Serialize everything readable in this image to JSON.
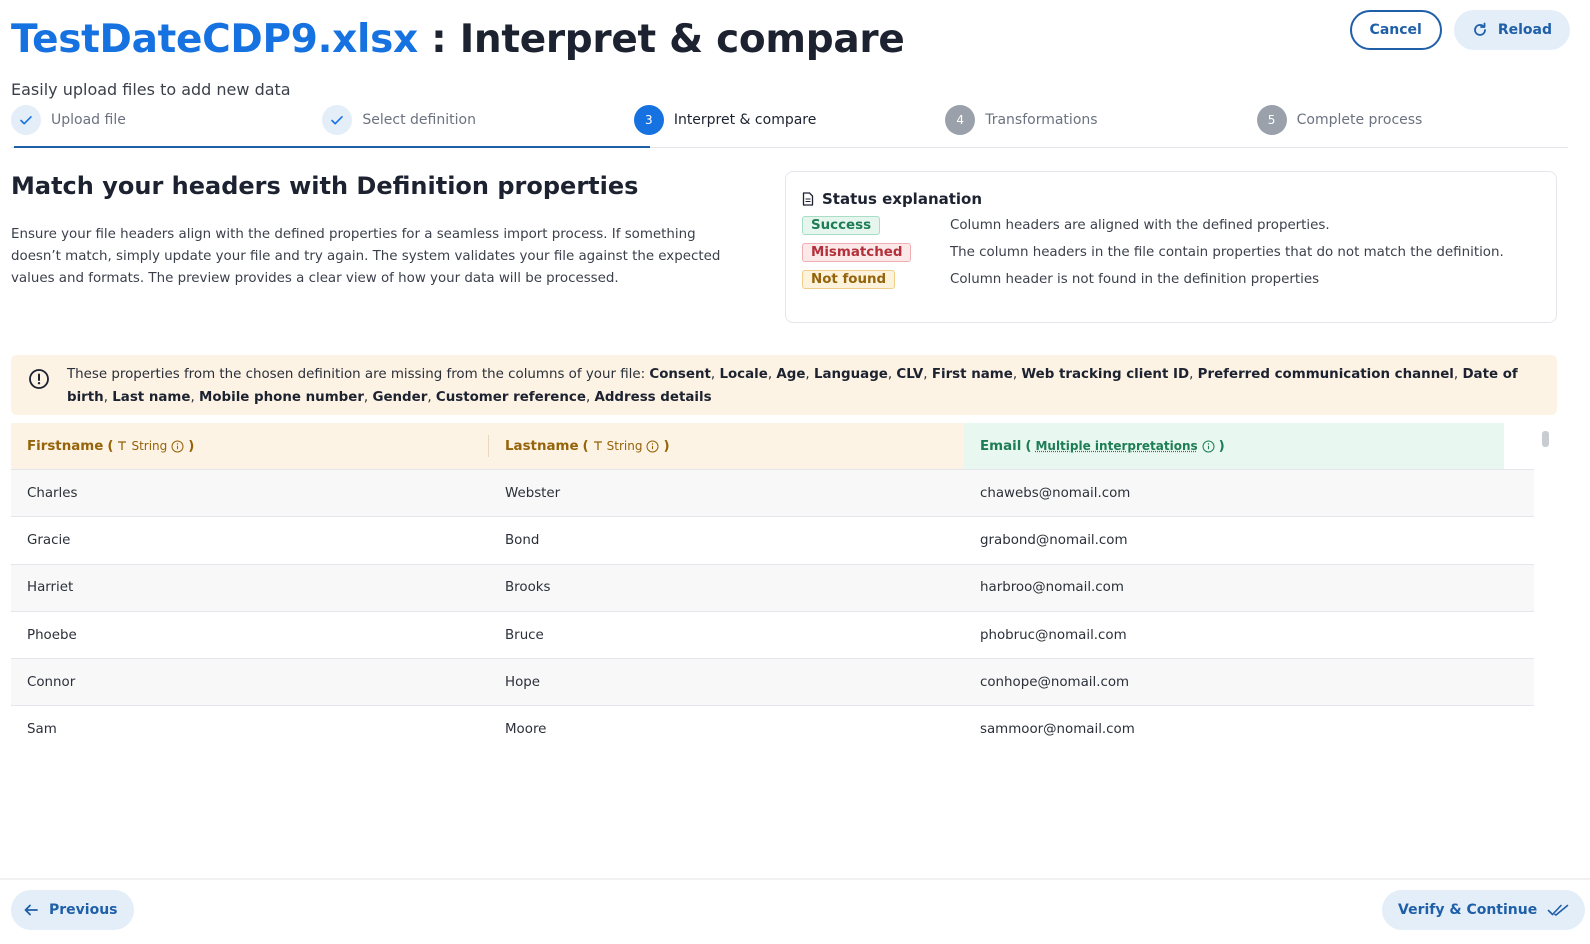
{
  "header": {
    "file_name": "TestDateCDP9.xlsx",
    "title_suffix": " : Interpret & compare",
    "subtitle": "Easily upload files to add new data",
    "cancel_label": "Cancel",
    "reload_label": "Reload"
  },
  "steps": [
    {
      "label": "Upload file",
      "state": "done",
      "number": "1"
    },
    {
      "label": "Select definition",
      "state": "done",
      "number": "2"
    },
    {
      "label": "Interpret & compare",
      "state": "active",
      "number": "3"
    },
    {
      "label": "Transformations",
      "state": "todo",
      "number": "4"
    },
    {
      "label": "Complete process",
      "state": "todo",
      "number": "5"
    }
  ],
  "match": {
    "heading": "Match your headers with Definition properties",
    "description": "Ensure your file headers align with the defined properties for a seamless import process. If something doesn’t match, simply update your file and try again. The system validates your file against the expected values and formats. The preview provides a clear view of how your data will be processed."
  },
  "status": {
    "heading": "Status explanation",
    "rows": [
      {
        "badge": "Success",
        "text": "Column headers are aligned with the defined properties."
      },
      {
        "badge": "Mismatched",
        "text": "The column headers in the file contain properties that do not match the definition."
      },
      {
        "badge": "Not found",
        "text": "Column header is not found in the definition properties"
      }
    ]
  },
  "alert": {
    "intro": "These properties from the chosen definition are missing from the columns of your file:",
    "missing": [
      "Consent",
      "Locale",
      "Age",
      "Language",
      "CLV",
      "First name",
      "Web tracking client ID",
      "Preferred communication channel",
      "Date of birth",
      "Last name",
      "Mobile phone number",
      "Gender",
      "Customer reference",
      "Address details"
    ]
  },
  "table": {
    "columns": [
      {
        "name": "Firstname",
        "type": "String"
      },
      {
        "name": "Lastname",
        "type": "String"
      },
      {
        "name": "Email",
        "type": "Multiple interpretations"
      }
    ],
    "rows": [
      [
        "Charles",
        "Webster",
        "chawebs@nomail.com"
      ],
      [
        "Gracie",
        "Bond",
        "grabond@nomail.com"
      ],
      [
        "Harriet",
        "Brooks",
        "harbroo@nomail.com"
      ],
      [
        "Phoebe",
        "Bruce",
        "phobruc@nomail.com"
      ],
      [
        "Connor",
        "Hope",
        "conhope@nomail.com"
      ],
      [
        "Sam",
        "Moore",
        "sammoor@nomail.com"
      ]
    ]
  },
  "footer": {
    "previous_label": "Previous",
    "next_label": "Verify & Continue"
  },
  "colors": {
    "brand": "#1672e0",
    "button_text": "#1f5fa8",
    "warning_bg": "#fdf3e4",
    "success_bg": "#e8f7ef"
  }
}
